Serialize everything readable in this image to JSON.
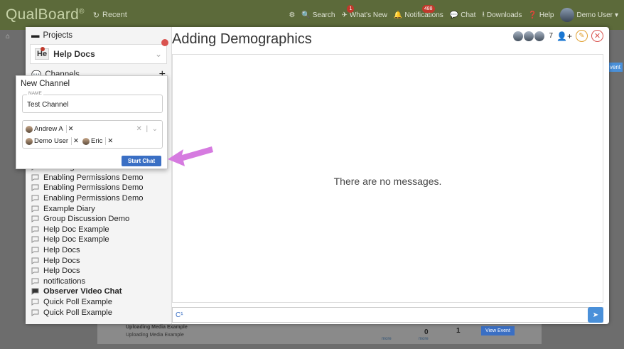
{
  "topbar": {
    "logo": "QualBoard",
    "reg": "®",
    "recent": "Recent",
    "search": "Search",
    "whats_new": "What's New",
    "whats_new_badge": "1",
    "notifications": "Notifications",
    "notifications_badge": "488",
    "chat": "Chat",
    "downloads": "Downloads",
    "help": "Help",
    "user": "Demo User"
  },
  "modal": {
    "projects_label": "Projects",
    "project_abbr": "He",
    "project_name": "Help Docs",
    "channels_label": "Channels",
    "title": "Adding Demographics",
    "participant_count": "7",
    "empty_message": "There are no messages."
  },
  "new_channel": {
    "title": "New Channel",
    "name_legend": "NAME",
    "name_value": "Test Channel",
    "members": [
      {
        "name": "Andrew A"
      },
      {
        "name": "Demo User"
      },
      {
        "name": "Eric"
      }
    ],
    "start_label": "Start Chat"
  },
  "channels": [
    {
      "name": "Enabling Permissions Demo",
      "bold": false
    },
    {
      "name": "Enabling Permissions Demo",
      "bold": false
    },
    {
      "name": "Enabling Permissions Demo",
      "bold": false
    },
    {
      "name": "Enabling Permissions Demo",
      "bold": false
    },
    {
      "name": "Example Diary",
      "bold": false
    },
    {
      "name": "Group Discussion Demo",
      "bold": false
    },
    {
      "name": "Help Doc Example",
      "bold": false
    },
    {
      "name": "Help Doc Example",
      "bold": false
    },
    {
      "name": "Help Docs",
      "bold": false
    },
    {
      "name": "Help Docs",
      "bold": false
    },
    {
      "name": "Help Docs",
      "bold": false
    },
    {
      "name": "notifications",
      "bold": false
    },
    {
      "name": "Observer Video Chat",
      "bold": true
    },
    {
      "name": "Quick Poll Example",
      "bold": false
    },
    {
      "name": "Quick Poll Example",
      "bold": false
    }
  ],
  "background": {
    "upload_title": "Uploading Media Example",
    "upload_sub": "Uploading Media Example",
    "count0": "0",
    "count1": "1",
    "more1": "more",
    "more2": "more",
    "view_event": "View Event",
    "event_partial": "vent"
  },
  "colors": {
    "topbar": "#5c6a3a",
    "accent": "#3a6fc4",
    "arrow": "#d67be0",
    "alert": "#d9534f"
  }
}
